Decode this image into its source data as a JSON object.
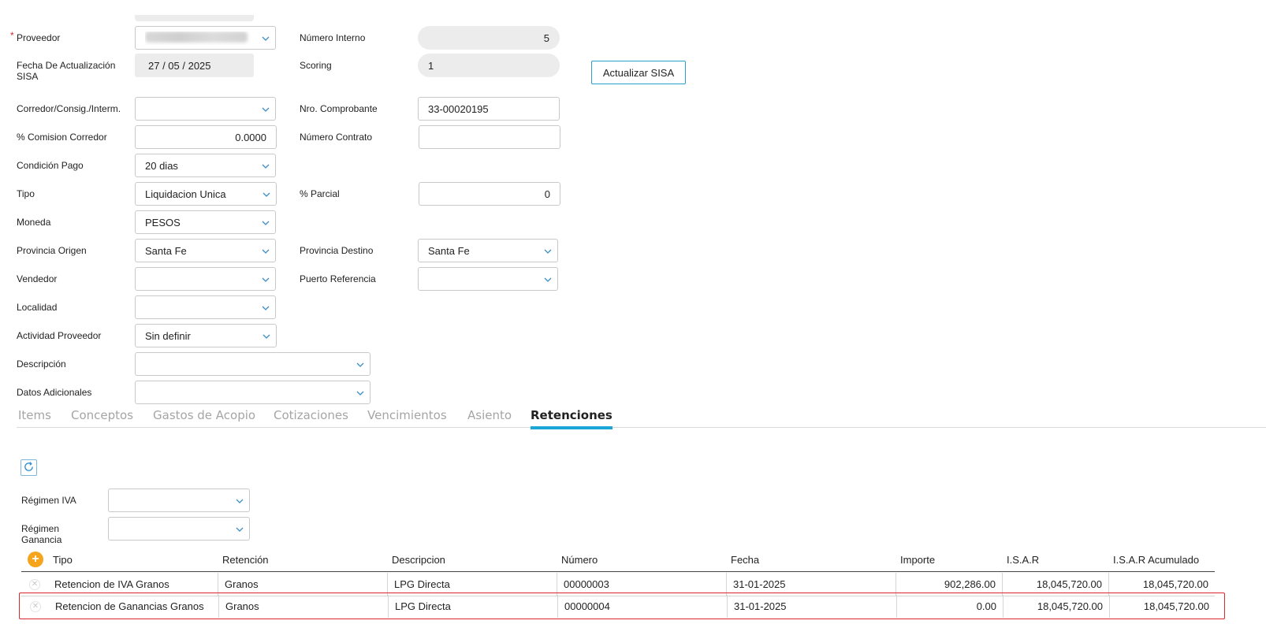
{
  "form": {
    "proveedor_label": "Proveedor",
    "required_mark": "*",
    "numero_interno_label": "Número Interno",
    "numero_interno_value": "5",
    "fecha_label": "Fecha De Actualización SISA",
    "fecha_value": "27 / 05 / 2025",
    "scoring_label": "Scoring",
    "scoring_value": "1",
    "actualizar_button": "Actualizar SISA",
    "corredor_label": "Corredor/Consig./Interm.",
    "corredor_value": "",
    "nro_comprobante_label": "Nro. Comprobante",
    "nro_comprobante_value": "33-00020195",
    "comision_label": "% Comision Corredor",
    "comision_value": "0.0000",
    "numero_contrato_label": "Número Contrato",
    "numero_contrato_value": "",
    "condicion_label": "Condición Pago",
    "condicion_value": "20 dias",
    "tipo_label": "Tipo",
    "tipo_value": "Liquidacion Unica",
    "parcial_label": "% Parcial",
    "parcial_value": "0",
    "moneda_label": "Moneda",
    "moneda_value": "PESOS",
    "prov_origen_label": "Provincia Origen",
    "prov_origen_value": "Santa Fe",
    "prov_destino_label": "Provincia Destino",
    "prov_destino_value": "Santa Fe",
    "vendedor_label": "Vendedor",
    "vendedor_value": "",
    "puerto_label": "Puerto Referencia",
    "puerto_value": "",
    "localidad_label": "Localidad",
    "localidad_value": "",
    "actividad_label": "Actividad Proveedor",
    "actividad_value": "Sin definir",
    "descripcion_label": "Descripción",
    "descripcion_value": "",
    "datos_label": "Datos Adicionales",
    "datos_value": ""
  },
  "tabs": [
    {
      "label": "Items"
    },
    {
      "label": "Conceptos"
    },
    {
      "label": "Gastos de Acopio"
    },
    {
      "label": "Cotizaciones"
    },
    {
      "label": "Vencimientos"
    },
    {
      "label": "Asiento"
    },
    {
      "label": "Retenciones",
      "active": true
    }
  ],
  "retenciones": {
    "regimen_iva_label": "Régimen IVA",
    "regimen_iva_value": "",
    "regimen_ganancia_label": "Régimen Ganancia",
    "regimen_ganancia_value": "",
    "columns": [
      "Tipo",
      "Retención",
      "Descripcion",
      "Número",
      "Fecha",
      "Importe",
      "I.S.A.R",
      "I.S.A.R Acumulado"
    ],
    "rows": [
      {
        "tipo": "Retencion de IVA Granos",
        "retencion": "Granos",
        "descripcion": "LPG Directa",
        "numero": "00000003",
        "fecha": "31-01-2025",
        "importe": "902,286.00",
        "isar": "18,045,720.00",
        "isar_acum": "18,045,720.00"
      },
      {
        "tipo": "Retencion de Ganancias Granos",
        "retencion": "Granos",
        "descripcion": "LPG Directa",
        "numero": "00000004",
        "fecha": "31-01-2025",
        "importe": "0.00",
        "isar": "18,045,720.00",
        "isar_acum": "18,045,720.00"
      }
    ]
  },
  "icons": {
    "chevron": "chevron-down-icon",
    "refresh": "refresh-icon",
    "add": "add-icon",
    "delete": "delete-icon"
  },
  "colors": {
    "accent": "#1aa6d6",
    "add_button": "#f5a41b",
    "selection_border": "#d9262c",
    "readonly_bg": "#ececec"
  }
}
